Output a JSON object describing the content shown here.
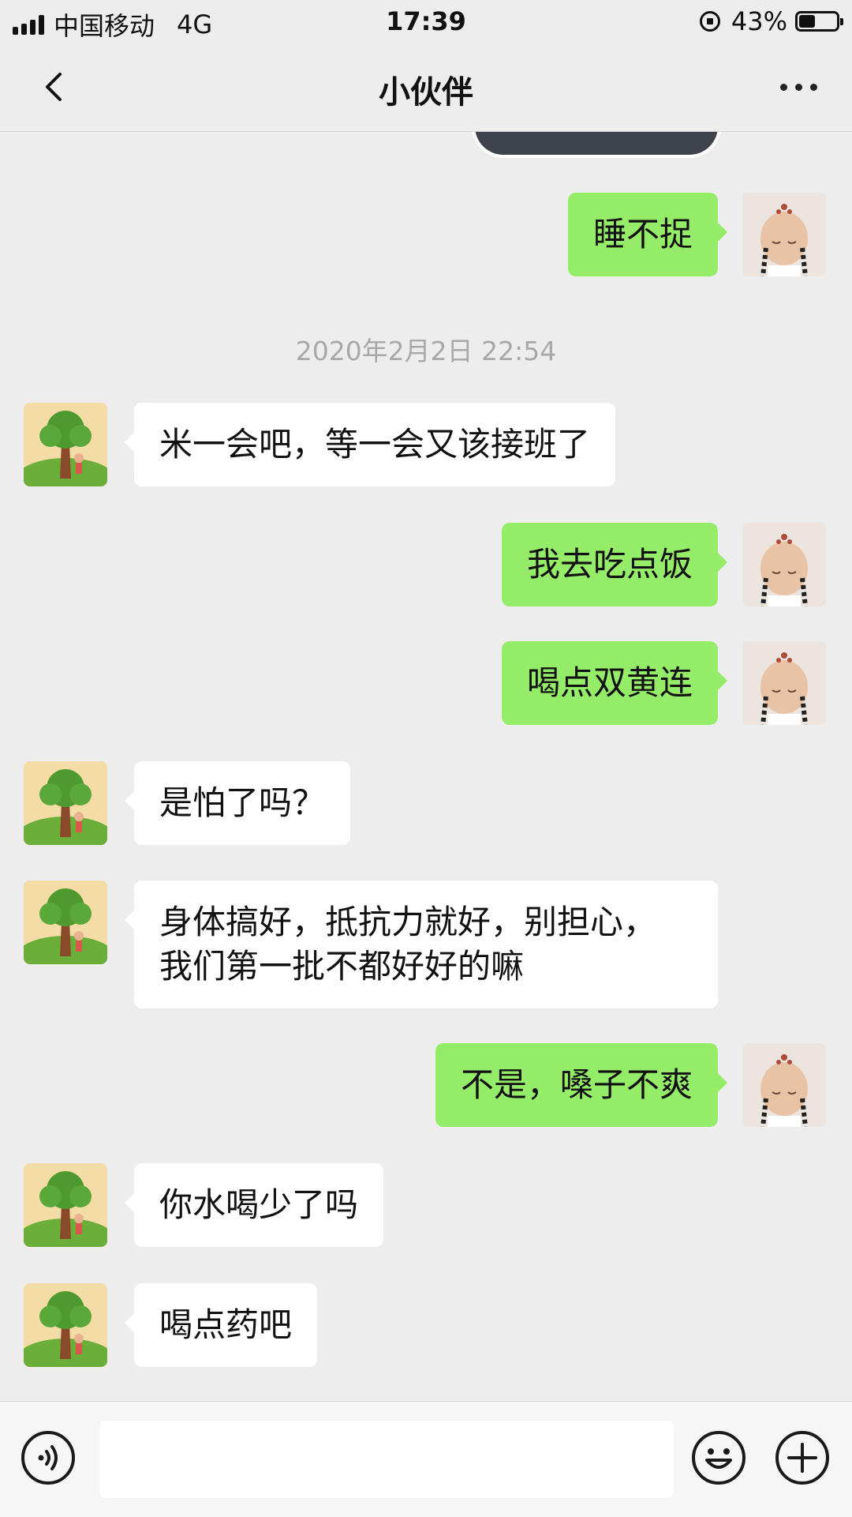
{
  "status_bar": {
    "carrier": "中国移动",
    "network": "4G",
    "time": "17:39",
    "battery": "43%",
    "battery_level": 0.43
  },
  "header": {
    "title": "小伙伴"
  },
  "timestamp": "2020年2月2日 22:54",
  "messages": [
    {
      "side": "out",
      "text": "睡不捉"
    },
    {
      "side": "in",
      "text": "米一会吧，等一会又该接班了"
    },
    {
      "side": "out",
      "text": "我去吃点饭"
    },
    {
      "side": "out",
      "text": "喝点双黄连"
    },
    {
      "side": "in",
      "text": "是怕了吗？"
    },
    {
      "side": "in",
      "text": "身体搞好，抵抗力就好，别担心，\n我们第一批不都好好的嘛"
    },
    {
      "side": "out",
      "text": "不是，嗓子不爽"
    },
    {
      "side": "in",
      "text": "你水喝少了吗"
    },
    {
      "side": "in",
      "text": "喝点药吧"
    }
  ],
  "colors": {
    "background": "#ededed",
    "outgoing_bubble": "#95ec69",
    "incoming_bubble": "#ffffff",
    "timestamp": "#a8a8a8"
  },
  "icons": {
    "back": "chevron-left-icon",
    "more": "more-dots-icon",
    "voice": "voice-icon",
    "emoji": "emoji-icon",
    "plus": "plus-icon"
  },
  "input": {
    "value": ""
  }
}
